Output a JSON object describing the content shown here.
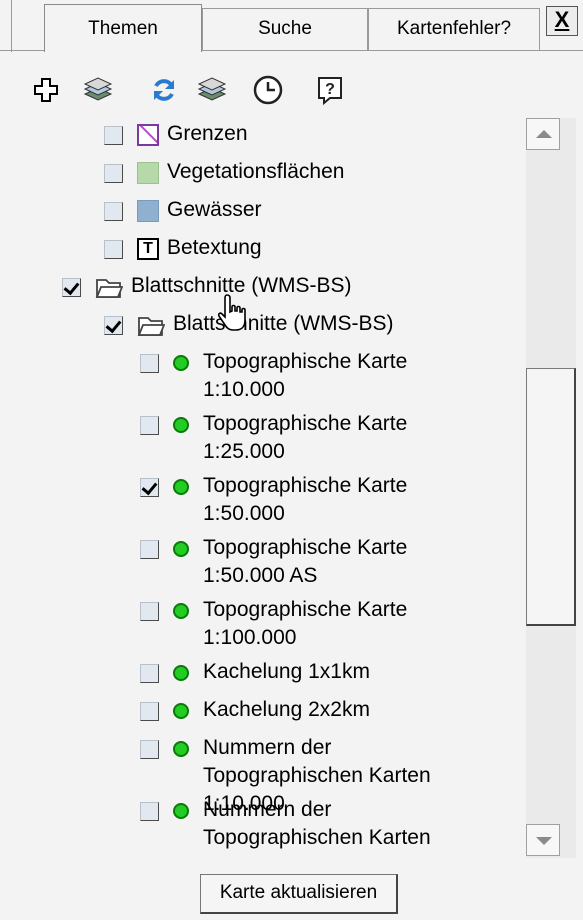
{
  "tabs": [
    {
      "label": "Themen",
      "active": true
    },
    {
      "label": "Suche",
      "active": false
    },
    {
      "label": "Kartenfehler?",
      "active": false
    }
  ],
  "close_label": "X",
  "toolbar": {
    "icons": [
      "add-layer-icon",
      "layers-icon",
      "refresh-icon",
      "layers-refresh-icon",
      "clock-icon",
      "help-icon"
    ],
    "help_glyph": "?"
  },
  "tree": {
    "items": [
      {
        "label": "Grenzen",
        "checked": false,
        "legend": "grenzen-legend-icon"
      },
      {
        "label": "Vegetationsflächen",
        "checked": false,
        "legend": "vegetation-legend-icon"
      },
      {
        "label": "Gewässer",
        "checked": false,
        "legend": "water-legend-icon"
      },
      {
        "label": "Betextung",
        "checked": false,
        "legend": "text-legend-icon",
        "legend_glyph": "T"
      },
      {
        "label": "Blattschnitte (WMS-BS)",
        "checked": true,
        "type": "folder"
      },
      {
        "label": "Blattschnitte (WMS-BS)",
        "checked": true,
        "type": "folder"
      },
      {
        "label": "Topographische Karte 1:10.000",
        "checked": false
      },
      {
        "label": "Topographische Karte 1:25.000",
        "checked": false
      },
      {
        "label": "Topographische Karte 1:50.000",
        "checked": true
      },
      {
        "label": "Topographische Karte 1:50.000 AS",
        "checked": false
      },
      {
        "label": "Topographische Karte 1:100.000",
        "checked": false
      },
      {
        "label": "Kachelung 1x1km",
        "checked": false
      },
      {
        "label": "Kachelung 2x2km",
        "checked": false
      },
      {
        "label": "Nummern der Topographischen Karten 1:10.000",
        "checked": false
      },
      {
        "label": "Nummern der Topographischen Karten",
        "checked": false
      }
    ]
  },
  "update_button": "Karte aktualisieren",
  "colors": {
    "status_dot": "#22cc22",
    "vegetation": "#b5d9a8",
    "water": "#8fb0cf",
    "boundary": "#7a3aa0"
  }
}
